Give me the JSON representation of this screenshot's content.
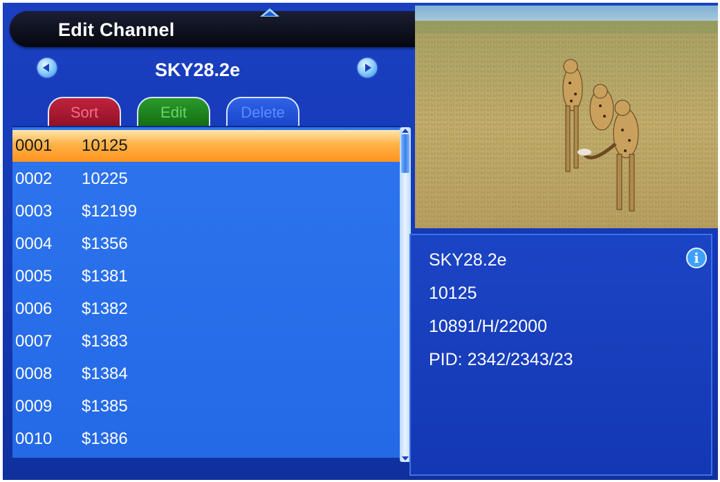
{
  "header": {
    "title": "Edit Channel"
  },
  "satellite": {
    "name": "SKY28.2e",
    "prev_icon": "arrow-left-circle-icon",
    "next_icon": "arrow-right-circle-icon"
  },
  "function_keys": [
    {
      "label": "Sort",
      "color": "#c2233e"
    },
    {
      "label": "Edit",
      "color": "#2a9a2a"
    },
    {
      "label": "Delete",
      "color": "#2f62e8"
    }
  ],
  "channels": [
    {
      "num": "0001",
      "name": "10125"
    },
    {
      "num": "0002",
      "name": "10225"
    },
    {
      "num": "0003",
      "name": "$12199"
    },
    {
      "num": "0004",
      "name": "$1356"
    },
    {
      "num": "0005",
      "name": "$1381"
    },
    {
      "num": "0006",
      "name": "$1382"
    },
    {
      "num": "0007",
      "name": "$1383"
    },
    {
      "num": "0008",
      "name": "$1384"
    },
    {
      "num": "0009",
      "name": "$1385"
    },
    {
      "num": "0010",
      "name": "$1386"
    }
  ],
  "selected_index": 0,
  "info": {
    "satellite": "SKY28.2e",
    "channel": "10125",
    "transponder": "10891/H/22000",
    "pid": "PID: 2342/2343/23",
    "icon": "info-icon"
  },
  "colors": {
    "background": "#1438b4",
    "selected_row": "#ff9f30",
    "list": "#2a70ec"
  }
}
